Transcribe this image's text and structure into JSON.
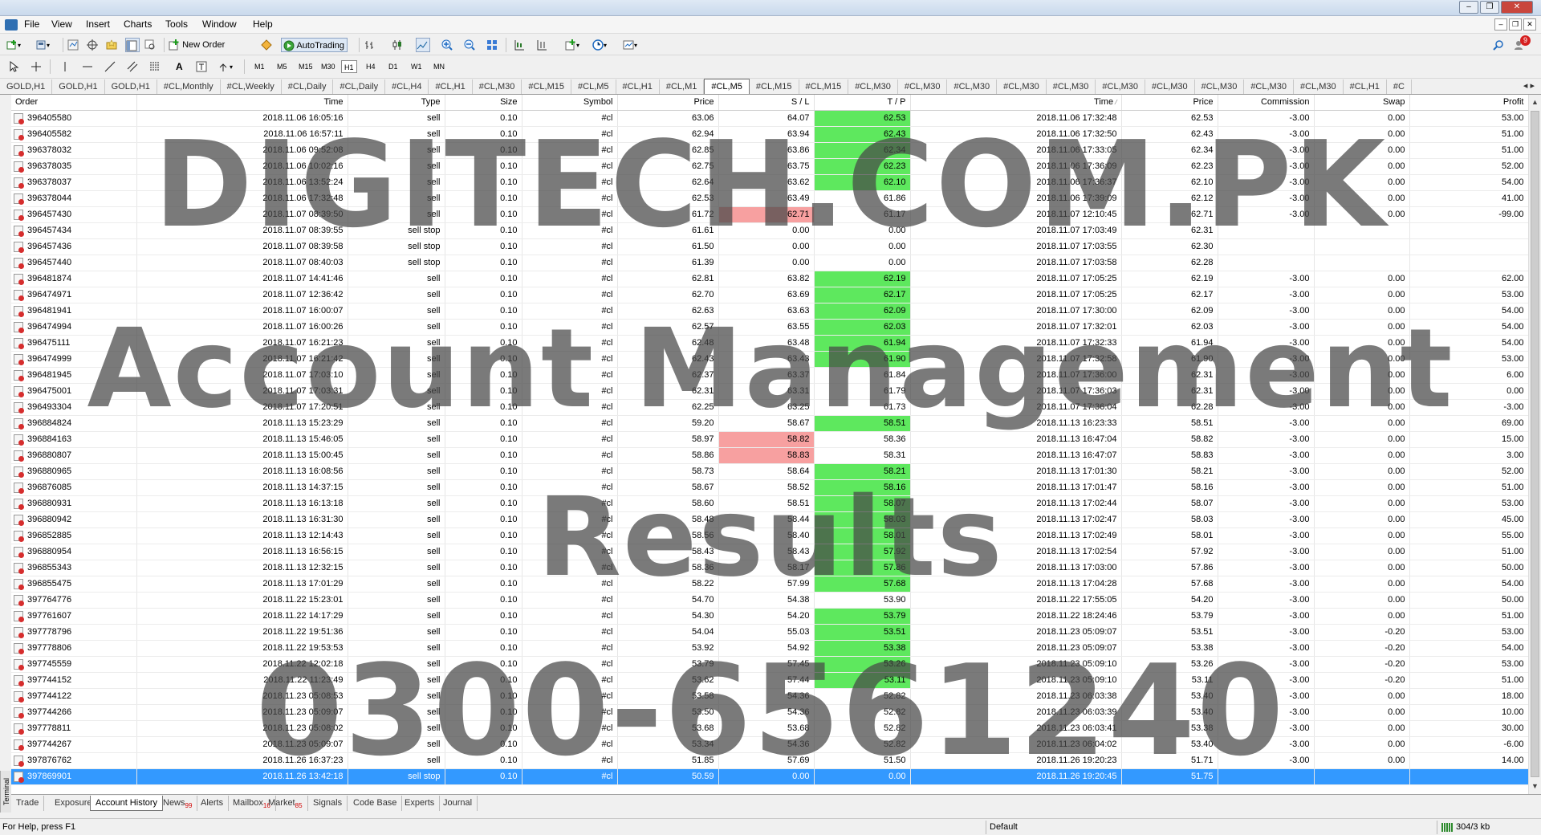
{
  "menu": [
    "File",
    "View",
    "Insert",
    "Charts",
    "Tools",
    "Window",
    "Help"
  ],
  "toolbar": {
    "new_order": "New Order",
    "autotrading": "AutoTrading",
    "timeframes": [
      "M1",
      "M5",
      "M15",
      "M30",
      "H1",
      "H4",
      "D1",
      "W1",
      "MN"
    ],
    "active_timeframe": "H1",
    "notification_count": "9"
  },
  "chart_tabs": [
    "GOLD,H1",
    "GOLD,H1",
    "GOLD,H1",
    "#CL,Monthly",
    "#CL,Weekly",
    "#CL,Daily",
    "#CL,Daily",
    "#CL,H4",
    "#CL,H1",
    "#CL,M30",
    "#CL,M15",
    "#CL,M5",
    "#CL,H1",
    "#CL,M1",
    "#CL,M5",
    "#CL,M15",
    "#CL,M15",
    "#CL,M30",
    "#CL,M30",
    "#CL,M30",
    "#CL,M30",
    "#CL,M30",
    "#CL,M30",
    "#CL,M30",
    "#CL,M30",
    "#CL,M30",
    "#CL,M30",
    "#CL,H1",
    "#C"
  ],
  "active_chart_tab": 14,
  "columns": [
    "Order",
    "Time",
    "Type",
    "Size",
    "Symbol",
    "Price",
    "S / L",
    "T / P",
    "Time",
    "Price",
    "Commission",
    "Swap",
    "Profit"
  ],
  "rows": [
    [
      "396405580",
      "2018.11.06 16:05:16",
      "sell",
      "0.10",
      "#cl",
      "63.06",
      "64.07",
      "62.53",
      "2018.11.06 17:32:48",
      "62.53",
      "-3.00",
      "0.00",
      "53.00",
      "",
      "g"
    ],
    [
      "396405582",
      "2018.11.06 16:57:11",
      "sell",
      "0.10",
      "#cl",
      "62.94",
      "63.94",
      "62.43",
      "2018.11.06 17:32:50",
      "62.43",
      "-3.00",
      "0.00",
      "51.00",
      "",
      "g"
    ],
    [
      "396378032",
      "2018.11.06 09:52:08",
      "sell",
      "0.10",
      "#cl",
      "62.85",
      "63.86",
      "62.34",
      "2018.11.06 17:33:05",
      "62.34",
      "-3.00",
      "0.00",
      "51.00",
      "",
      "g"
    ],
    [
      "396378035",
      "2018.11.06 10:02:16",
      "sell",
      "0.10",
      "#cl",
      "62.75",
      "63.75",
      "62.23",
      "2018.11.06 17:36:09",
      "62.23",
      "-3.00",
      "0.00",
      "52.00",
      "",
      "g"
    ],
    [
      "396378037",
      "2018.11.06 13:52:24",
      "sell",
      "0.10",
      "#cl",
      "62.64",
      "63.62",
      "62.10",
      "2018.11.06 17:36:37",
      "62.10",
      "-3.00",
      "0.00",
      "54.00",
      "",
      "g"
    ],
    [
      "396378044",
      "2018.11.06 17:32:48",
      "sell",
      "0.10",
      "#cl",
      "62.53",
      "63.49",
      "61.86",
      "2018.11.06 17:39:09",
      "62.12",
      "-3.00",
      "0.00",
      "41.00",
      "",
      ""
    ],
    [
      "396457430",
      "2018.11.07 08:39:50",
      "sell",
      "0.10",
      "#cl",
      "61.72",
      "62.71",
      "61.17",
      "2018.11.07 12:10:45",
      "62.71",
      "-3.00",
      "0.00",
      "-99.00",
      "r",
      ""
    ],
    [
      "396457434",
      "2018.11.07 08:39:55",
      "sell stop",
      "0.10",
      "#cl",
      "61.61",
      "0.00",
      "0.00",
      "2018.11.07 17:03:49",
      "62.31",
      "",
      "",
      "",
      "",
      ""
    ],
    [
      "396457436",
      "2018.11.07 08:39:58",
      "sell stop",
      "0.10",
      "#cl",
      "61.50",
      "0.00",
      "0.00",
      "2018.11.07 17:03:55",
      "62.30",
      "",
      "",
      "",
      "",
      ""
    ],
    [
      "396457440",
      "2018.11.07 08:40:03",
      "sell stop",
      "0.10",
      "#cl",
      "61.39",
      "0.00",
      "0.00",
      "2018.11.07 17:03:58",
      "62.28",
      "",
      "",
      "",
      "",
      ""
    ],
    [
      "396481874",
      "2018.11.07 14:41:46",
      "sell",
      "0.10",
      "#cl",
      "62.81",
      "63.82",
      "62.19",
      "2018.11.07 17:05:25",
      "62.19",
      "-3.00",
      "0.00",
      "62.00",
      "",
      "g"
    ],
    [
      "396474971",
      "2018.11.07 12:36:42",
      "sell",
      "0.10",
      "#cl",
      "62.70",
      "63.69",
      "62.17",
      "2018.11.07 17:05:25",
      "62.17",
      "-3.00",
      "0.00",
      "53.00",
      "",
      "g"
    ],
    [
      "396481941",
      "2018.11.07 16:00:07",
      "sell",
      "0.10",
      "#cl",
      "62.63",
      "63.63",
      "62.09",
      "2018.11.07 17:30:00",
      "62.09",
      "-3.00",
      "0.00",
      "54.00",
      "",
      "g"
    ],
    [
      "396474994",
      "2018.11.07 16:00:26",
      "sell",
      "0.10",
      "#cl",
      "62.57",
      "63.55",
      "62.03",
      "2018.11.07 17:32:01",
      "62.03",
      "-3.00",
      "0.00",
      "54.00",
      "",
      "g"
    ],
    [
      "396475111",
      "2018.11.07 16:21:23",
      "sell",
      "0.10",
      "#cl",
      "62.48",
      "63.48",
      "61.94",
      "2018.11.07 17:32:33",
      "61.94",
      "-3.00",
      "0.00",
      "54.00",
      "",
      "g"
    ],
    [
      "396474999",
      "2018.11.07 16:21:42",
      "sell",
      "0.10",
      "#cl",
      "62.43",
      "63.43",
      "61.90",
      "2018.11.07 17:32:58",
      "61.90",
      "-3.00",
      "0.00",
      "53.00",
      "",
      "g"
    ],
    [
      "396481945",
      "2018.11.07 17:03:10",
      "sell",
      "0.10",
      "#cl",
      "62.37",
      "63.37",
      "61.84",
      "2018.11.07 17:36:00",
      "62.31",
      "-3.00",
      "0.00",
      "6.00",
      "",
      ""
    ],
    [
      "396475001",
      "2018.11.07 17:03:31",
      "sell",
      "0.10",
      "#cl",
      "62.31",
      "63.31",
      "61.79",
      "2018.11.07 17:36:03",
      "62.31",
      "-3.00",
      "0.00",
      "0.00",
      "",
      ""
    ],
    [
      "396493304",
      "2018.11.07 17:20:51",
      "sell",
      "0.10",
      "#cl",
      "62.25",
      "63.25",
      "61.73",
      "2018.11.07 17:36:04",
      "62.28",
      "-3.00",
      "0.00",
      "-3.00",
      "",
      ""
    ],
    [
      "396884824",
      "2018.11.13 15:23:29",
      "sell",
      "0.10",
      "#cl",
      "59.20",
      "58.67",
      "58.51",
      "2018.11.13 16:23:33",
      "58.51",
      "-3.00",
      "0.00",
      "69.00",
      "",
      "g"
    ],
    [
      "396884163",
      "2018.11.13 15:46:05",
      "sell",
      "0.10",
      "#cl",
      "58.97",
      "58.82",
      "58.36",
      "2018.11.13 16:47:04",
      "58.82",
      "-3.00",
      "0.00",
      "15.00",
      "r",
      ""
    ],
    [
      "396880807",
      "2018.11.13 15:00:45",
      "sell",
      "0.10",
      "#cl",
      "58.86",
      "58.83",
      "58.31",
      "2018.11.13 16:47:07",
      "58.83",
      "-3.00",
      "0.00",
      "3.00",
      "r",
      ""
    ],
    [
      "396880965",
      "2018.11.13 16:08:56",
      "sell",
      "0.10",
      "#cl",
      "58.73",
      "58.64",
      "58.21",
      "2018.11.13 17:01:30",
      "58.21",
      "-3.00",
      "0.00",
      "52.00",
      "",
      "g"
    ],
    [
      "396876085",
      "2018.11.13 14:37:15",
      "sell",
      "0.10",
      "#cl",
      "58.67",
      "58.52",
      "58.16",
      "2018.11.13 17:01:47",
      "58.16",
      "-3.00",
      "0.00",
      "51.00",
      "",
      "g"
    ],
    [
      "396880931",
      "2018.11.13 16:13:18",
      "sell",
      "0.10",
      "#cl",
      "58.60",
      "58.51",
      "58.07",
      "2018.11.13 17:02:44",
      "58.07",
      "-3.00",
      "0.00",
      "53.00",
      "",
      "g"
    ],
    [
      "396880942",
      "2018.11.13 16:31:30",
      "sell",
      "0.10",
      "#cl",
      "58.48",
      "58.44",
      "58.03",
      "2018.11.13 17:02:47",
      "58.03",
      "-3.00",
      "0.00",
      "45.00",
      "",
      "g"
    ],
    [
      "396852885",
      "2018.11.13 12:14:43",
      "sell",
      "0.10",
      "#cl",
      "58.56",
      "58.40",
      "58.01",
      "2018.11.13 17:02:49",
      "58.01",
      "-3.00",
      "0.00",
      "55.00",
      "",
      "g"
    ],
    [
      "396880954",
      "2018.11.13 16:56:15",
      "sell",
      "0.10",
      "#cl",
      "58.43",
      "58.43",
      "57.92",
      "2018.11.13 17:02:54",
      "57.92",
      "-3.00",
      "0.00",
      "51.00",
      "",
      "g"
    ],
    [
      "396855343",
      "2018.11.13 12:32:15",
      "sell",
      "0.10",
      "#cl",
      "58.36",
      "58.17",
      "57.86",
      "2018.11.13 17:03:00",
      "57.86",
      "-3.00",
      "0.00",
      "50.00",
      "",
      "g"
    ],
    [
      "396855475",
      "2018.11.13 17:01:29",
      "sell",
      "0.10",
      "#cl",
      "58.22",
      "57.99",
      "57.68",
      "2018.11.13 17:04:28",
      "57.68",
      "-3.00",
      "0.00",
      "54.00",
      "",
      "g"
    ],
    [
      "397764776",
      "2018.11.22 15:23:01",
      "sell",
      "0.10",
      "#cl",
      "54.70",
      "54.38",
      "53.90",
      "2018.11.22 17:55:05",
      "54.20",
      "-3.00",
      "0.00",
      "50.00",
      "",
      ""
    ],
    [
      "397761607",
      "2018.11.22 14:17:29",
      "sell",
      "0.10",
      "#cl",
      "54.30",
      "54.20",
      "53.79",
      "2018.11.22 18:24:46",
      "53.79",
      "-3.00",
      "0.00",
      "51.00",
      "",
      "g"
    ],
    [
      "397778796",
      "2018.11.22 19:51:36",
      "sell",
      "0.10",
      "#cl",
      "54.04",
      "55.03",
      "53.51",
      "2018.11.23 05:09:07",
      "53.51",
      "-3.00",
      "-0.20",
      "53.00",
      "",
      "g"
    ],
    [
      "397778806",
      "2018.11.22 19:53:53",
      "sell",
      "0.10",
      "#cl",
      "53.92",
      "54.92",
      "53.38",
      "2018.11.23 05:09:07",
      "53.38",
      "-3.00",
      "-0.20",
      "54.00",
      "",
      "g"
    ],
    [
      "397745559",
      "2018.11.22 12:02:18",
      "sell",
      "0.10",
      "#cl",
      "53.79",
      "57.45",
      "53.26",
      "2018.11.23 05:09:10",
      "53.26",
      "-3.00",
      "-0.20",
      "53.00",
      "",
      "g"
    ],
    [
      "397744152",
      "2018.11.22 11:23:49",
      "sell",
      "0.10",
      "#cl",
      "53.62",
      "57.44",
      "53.11",
      "2018.11.23 05:09:10",
      "53.11",
      "-3.00",
      "-0.20",
      "51.00",
      "",
      "g"
    ],
    [
      "397744122",
      "2018.11.23 05:08:53",
      "sell",
      "0.10",
      "#cl",
      "53.58",
      "54.36",
      "52.82",
      "2018.11.23 06:03:38",
      "53.40",
      "-3.00",
      "0.00",
      "18.00",
      "",
      ""
    ],
    [
      "397744266",
      "2018.11.23 05:09:07",
      "sell",
      "0.10",
      "#cl",
      "53.50",
      "54.36",
      "52.82",
      "2018.11.23 06:03:39",
      "53.40",
      "-3.00",
      "0.00",
      "10.00",
      "",
      ""
    ],
    [
      "397778811",
      "2018.11.23 05:08:02",
      "sell",
      "0.10",
      "#cl",
      "53.68",
      "53.68",
      "52.82",
      "2018.11.23 06:03:41",
      "53.38",
      "-3.00",
      "0.00",
      "30.00",
      "",
      ""
    ],
    [
      "397744267",
      "2018.11.23 05:09:07",
      "sell",
      "0.10",
      "#cl",
      "53.34",
      "54.36",
      "52.82",
      "2018.11.23 06:04:02",
      "53.40",
      "-3.00",
      "0.00",
      "-6.00",
      "",
      ""
    ],
    [
      "397876762",
      "2018.11.26 16:37:23",
      "sell",
      "0.10",
      "#cl",
      "51.85",
      "57.69",
      "51.50",
      "2018.11.26 19:20:23",
      "51.71",
      "-3.00",
      "0.00",
      "14.00",
      "",
      ""
    ],
    [
      "397869901",
      "2018.11.26 13:42:18",
      "sell stop",
      "0.10",
      "#cl",
      "50.59",
      "0.00",
      "0.00",
      "2018.11.26 19:20:45",
      "51.75",
      "",
      "",
      "",
      "",
      ""
    ]
  ],
  "selected_row": 41,
  "terminal_label": "Terminal",
  "bottom_tabs": [
    {
      "label": "Trade",
      "badge": ""
    },
    {
      "label": "Exposure",
      "badge": ""
    },
    {
      "label": "Account History",
      "badge": ""
    },
    {
      "label": "News",
      "badge": "99"
    },
    {
      "label": "Alerts",
      "badge": ""
    },
    {
      "label": "Mailbox",
      "badge": "16"
    },
    {
      "label": "Market",
      "badge": "85"
    },
    {
      "label": "Signals",
      "badge": ""
    },
    {
      "label": "Code Base",
      "badge": ""
    },
    {
      "label": "Experts",
      "badge": ""
    },
    {
      "label": "Journal",
      "badge": ""
    }
  ],
  "active_bottom_tab": 2,
  "status": {
    "help": "For Help, press F1",
    "profile": "Default",
    "connection": "304/3 kb"
  },
  "watermark": {
    "line1": "DIGITECH.COM.PK",
    "line2": "Account Management",
    "line3": "Results",
    "line4": "0300-6561240"
  },
  "colors": {
    "tp_hit": "#5ee85e",
    "sl_hit": "#f7a0a0",
    "selected": "#3399ff"
  }
}
